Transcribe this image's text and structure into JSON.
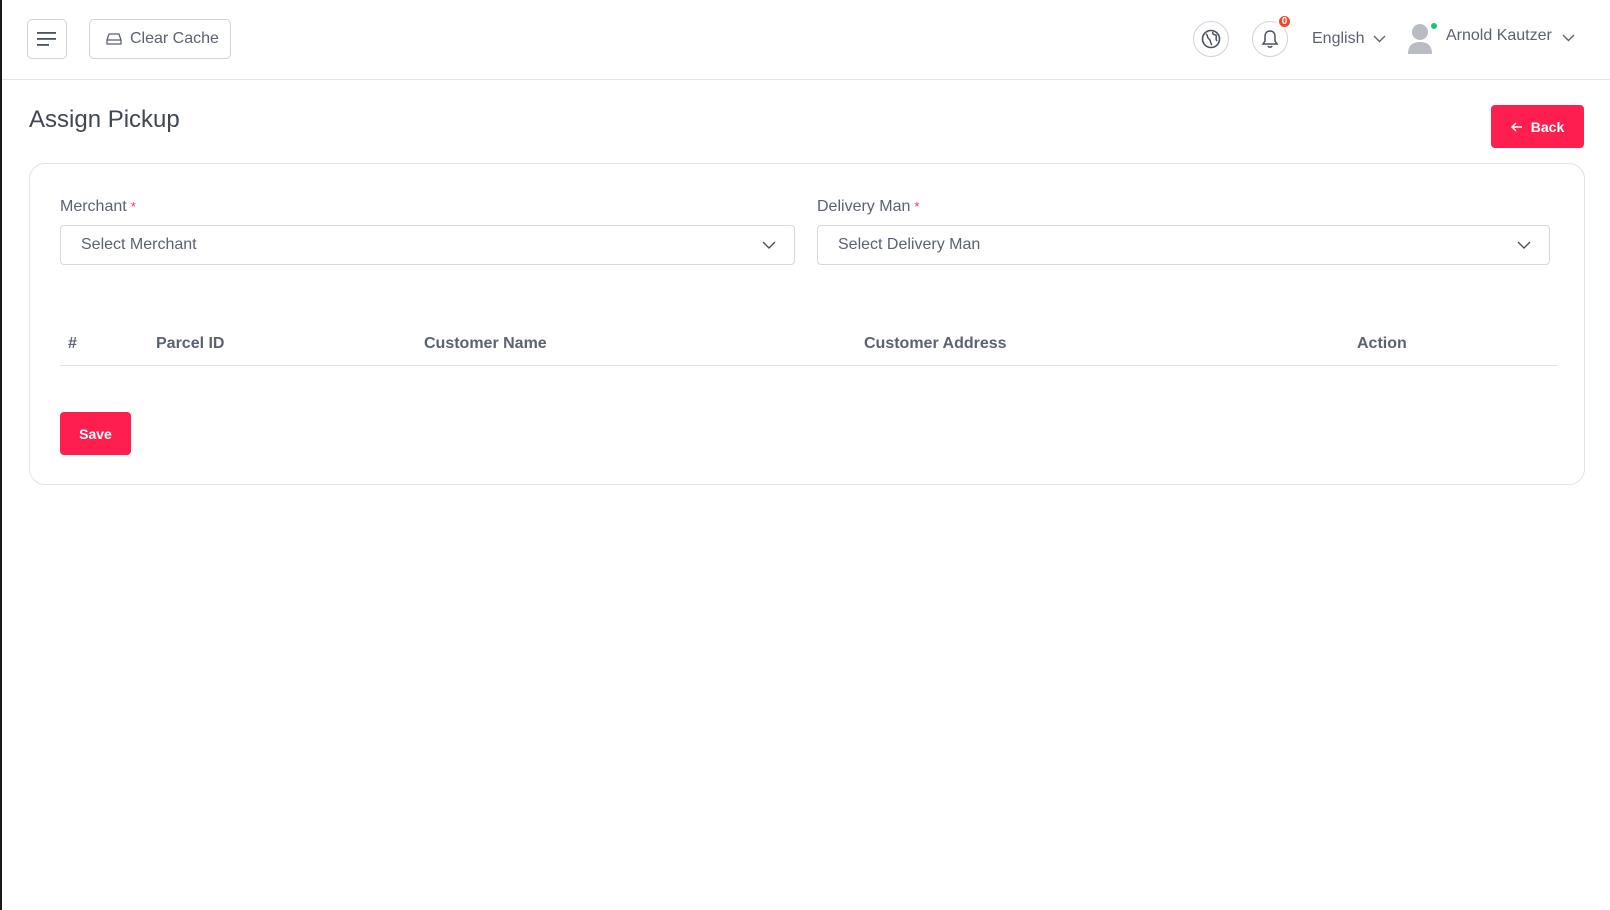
{
  "header": {
    "clear_cache_label": "Clear Cache",
    "notification_count": "0",
    "language": "English",
    "user_name": "Arnold Kautzer"
  },
  "page": {
    "title": "Assign Pickup",
    "back_label": "Back"
  },
  "form": {
    "merchant": {
      "label": "Merchant",
      "required_mark": "*",
      "placeholder": "Select Merchant"
    },
    "delivery_man": {
      "label": "Delivery Man",
      "required_mark": "*",
      "placeholder": "Select Delivery Man"
    }
  },
  "table": {
    "columns": [
      "#",
      "Parcel ID",
      "Customer Name",
      "Customer Address",
      "Action"
    ]
  },
  "save_label": "Save",
  "colors": {
    "accent": "#ff1f4f",
    "badge": "#ef4b2a",
    "online": "#21c27a"
  },
  "icons": {
    "menu": "hamburger-icon",
    "cache": "drive-icon",
    "globe": "globe-icon",
    "bell": "bell-icon",
    "user": "user-avatar-icon",
    "back": "arrow-left-icon",
    "chevron": "chevron-down-icon"
  }
}
